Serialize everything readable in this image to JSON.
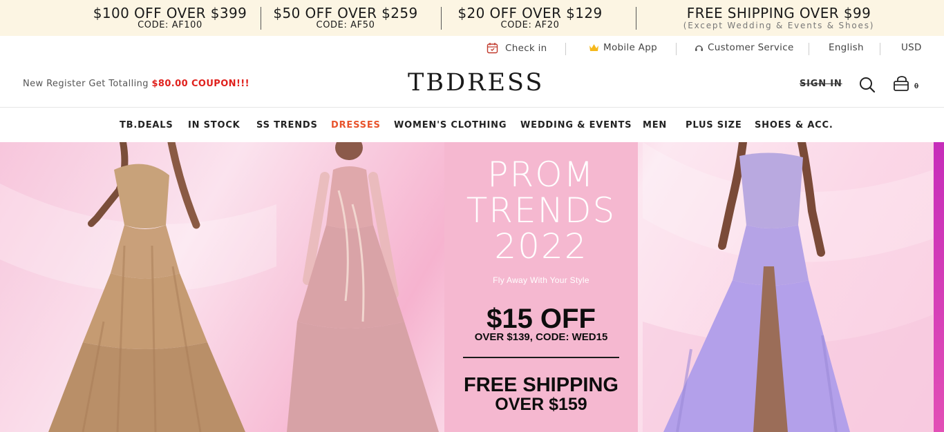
{
  "promo_bar": {
    "items": [
      {
        "title": "$100 OFF OVER $399",
        "code": "CODE: AF100"
      },
      {
        "title": "$50 OFF OVER $259",
        "code": "CODE: AF50"
      },
      {
        "title": "$20 OFF OVER $129",
        "code": "CODE: AF20"
      },
      {
        "title": "FREE SHIPPING OVER $99",
        "sub": "(Except Wedding & Events & Shoes)"
      }
    ]
  },
  "utility": {
    "check_in": "Check in",
    "mobile_app": "Mobile App",
    "customer_service": "Customer Service",
    "language": "English",
    "currency": "USD"
  },
  "header": {
    "register_prefix": "New Register Get Totalling ",
    "register_amount": "$80.00 COUPON",
    "register_suffix": "!!!",
    "logo": "TBDRESS",
    "sign_in": "SIGN IN",
    "cart_count": "0"
  },
  "nav": {
    "items": [
      "TB.DEALS",
      "IN STOCK",
      "SS TRENDS",
      "DRESSES",
      "WOMEN'S CLOTHING",
      "WEDDING & EVENTS",
      "MEN",
      "PLUS SIZE",
      "SHOES & ACC."
    ],
    "active": "DRESSES",
    "active_color": "#e8532c"
  },
  "banner": {
    "headline": [
      "PROM",
      "TRENDS",
      "2022"
    ],
    "tagline": "Fly Away With Your Style",
    "offer_main": "$15 OFF",
    "offer_sub": "OVER $139, CODE: WED15",
    "shipping_main": "FREE SHIPPING",
    "shipping_sub": "OVER $159",
    "panel_color": "#f5b8d0"
  },
  "icons": [
    "calendar-icon",
    "crown-icon",
    "headset-icon",
    "search-icon",
    "cart-icon"
  ]
}
